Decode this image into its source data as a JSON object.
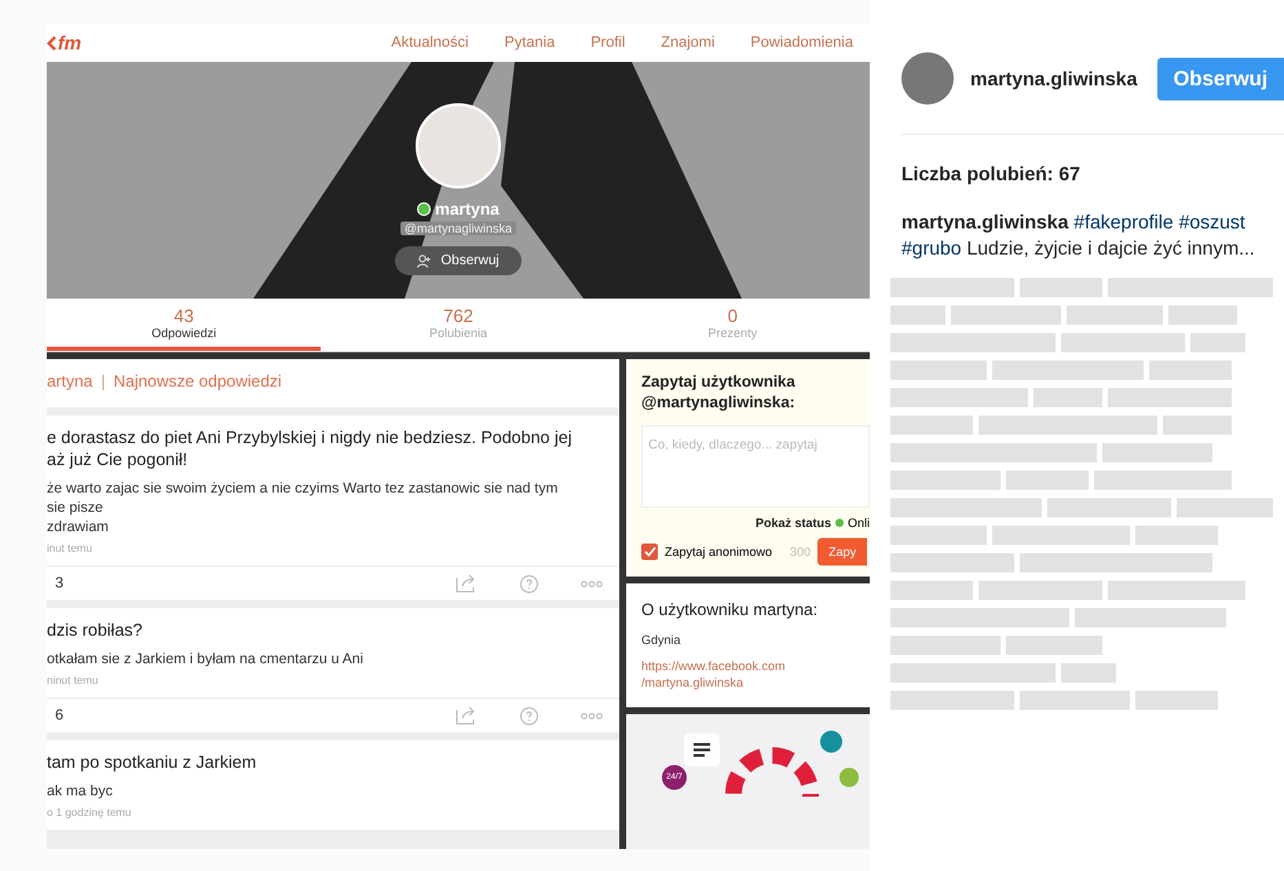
{
  "askfm": {
    "logo": "fm",
    "nav": [
      "Aktualności",
      "Pytania",
      "Profil",
      "Znajomi",
      "Powiadomienia"
    ],
    "profile": {
      "name": "martyna",
      "online": true,
      "handle": "@martynagliwinska",
      "follow": "Obserwuj"
    },
    "tabs": [
      {
        "count": "43",
        "label": "Odpowiedzi",
        "selected": true
      },
      {
        "count": "762",
        "label": "Polubienia",
        "selected": false
      },
      {
        "count": "0",
        "label": "Prezenty",
        "selected": false
      }
    ],
    "feed_header": {
      "user": "artyna",
      "separator": "|",
      "title": "Najnowsze odpowiedzi"
    },
    "answers": [
      {
        "question": [
          "e dorastasz do piet Ani Przybylskiej i nigdy nie bedziesz. Podobno jej",
          "aż już Cie pogonił!"
        ],
        "answer": [
          "że warto zajac sie swoim życiem a nie czyims Warto tez zastanowic sie nad tym",
          "sie pisze",
          "zdrawiam"
        ],
        "time": "inut temu",
        "likes": "3"
      },
      {
        "question": [
          "dzis robiłas?"
        ],
        "answer": [
          "otkałam sie z Jarkiem i byłam na cmentarzu u Ani"
        ],
        "time": "ninut temu",
        "likes": "6"
      },
      {
        "question": [
          "tam po spotkaniu z Jarkiem"
        ],
        "answer": [
          "ak ma byc"
        ],
        "time": "o 1 godzinę temu"
      }
    ],
    "ask_box": {
      "title": "Zapytaj użytkownika @martynagliwinska:",
      "placeholder": "Co, kiedy, dlaczego... zapytaj",
      "status_label": "Pokaż status",
      "status": "Onli",
      "anonymous": {
        "label": "Zapytaj anonimowo",
        "checked": true
      },
      "counter": "300",
      "submit": "Zapy"
    },
    "about": {
      "title": "O użytkowniku martyna:",
      "city": "Gdynia",
      "link": [
        "https://www.facebook.com",
        "/martyna.gliwinska"
      ]
    },
    "help_badge": "24/7"
  },
  "post": {
    "username": "martyna.gliwinska",
    "follow": "Obserwuj",
    "likes": "Liczba polubień: 67",
    "caption": {
      "user": "martyna.gliwinska",
      "tags_line1": [
        "#fakeprofile",
        "#oszust"
      ],
      "tags_line2": [
        "#grubo"
      ],
      "text": "Ludzie, żyjcie i dajcie żyć innym..."
    }
  }
}
